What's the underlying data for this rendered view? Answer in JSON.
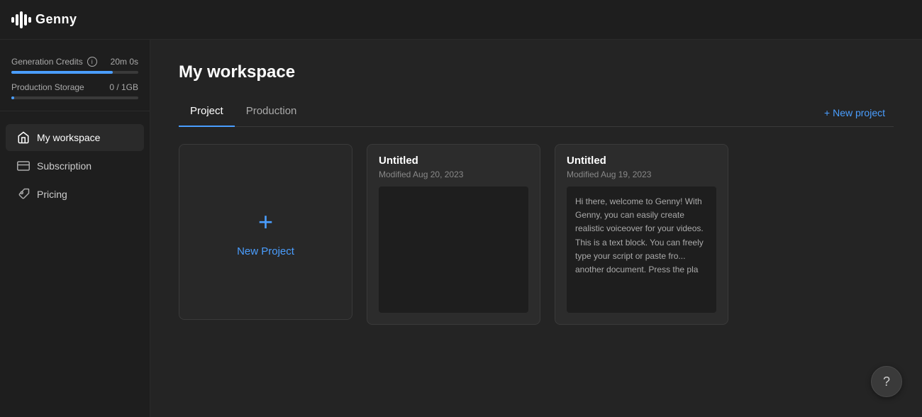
{
  "header": {
    "logo_text": "Genny",
    "logo_icon": "waveform"
  },
  "sidebar": {
    "credits": {
      "label": "Generation Credits",
      "value": "20m 0s",
      "progress_percent": 80
    },
    "storage": {
      "label": "Production Storage",
      "value": "0 / 1GB",
      "progress_percent": 2
    },
    "nav_items": [
      {
        "id": "my-workspace",
        "label": "My workspace",
        "icon": "home",
        "active": true
      },
      {
        "id": "subscription",
        "label": "Subscription",
        "icon": "credit-card",
        "active": false
      },
      {
        "id": "pricing",
        "label": "Pricing",
        "icon": "tag",
        "active": false
      }
    ]
  },
  "content": {
    "page_title": "My workspace",
    "tabs": [
      {
        "id": "project",
        "label": "Project",
        "active": true
      },
      {
        "id": "production",
        "label": "Production",
        "active": false
      }
    ],
    "new_project_button": "+ New project",
    "new_project_card_label": "New Project",
    "cards": [
      {
        "id": "card1",
        "title": "Untitled",
        "date": "Modified Aug 20, 2023",
        "preview": ""
      },
      {
        "id": "card2",
        "title": "Untitled",
        "date": "Modified Aug 19, 2023",
        "preview": "Hi there, welcome to Genny! With Genny, you can easily create realistic voiceover for your videos. This is a text block. You can freely type your script or paste fro... another document. Press the pla"
      }
    ]
  },
  "help": {
    "label": "?"
  }
}
